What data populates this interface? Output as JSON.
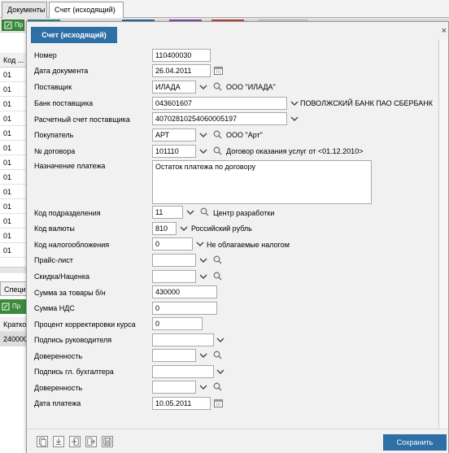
{
  "tabs": [
    {
      "label": "Документы"
    },
    {
      "label": "Счет (исходящий)",
      "close": "×"
    }
  ],
  "background": {
    "toolbar_label": "Пр",
    "column_header": "Код ...",
    "rows": [
      "01",
      "01",
      "01",
      "01",
      "01",
      "01",
      "01",
      "01",
      "01",
      "01",
      "01",
      "01",
      "01"
    ],
    "section_tab": "Специ",
    "section_toolbar_label": "Пр",
    "section_header": "Кратко",
    "section_row": "240000"
  },
  "dialog": {
    "title": "Счет (исходящий)",
    "close": "×",
    "fields": {
      "number": {
        "label": "Номер",
        "value": "110400030"
      },
      "doc_date": {
        "label": "Дата документа",
        "value": "26.04.2011"
      },
      "supplier": {
        "label": "Поставщик",
        "value": "ИЛАДА",
        "desc": "ООО \"ИЛАДА\""
      },
      "supplier_bank": {
        "label": "Банк поставщика",
        "value": "043601607",
        "desc": "ПОВОЛЖСКИЙ БАНК ПАО СБЕРБАНК"
      },
      "supplier_account": {
        "label": "Расчетный счет поставщика",
        "value": "40702810254060005197"
      },
      "buyer": {
        "label": "Покупатель",
        "value": "АРТ",
        "desc": "ООО \"Арт\""
      },
      "contract": {
        "label": "№ договора",
        "value": "101110",
        "desc": "Договор оказания услуг от <01.12.2010>"
      },
      "purpose": {
        "label": "Назначение платежа",
        "value": "Остаток платежа по договору"
      },
      "department": {
        "label": "Код подразделения",
        "value": "11",
        "desc": "Центр разработки"
      },
      "currency": {
        "label": "Код валюты",
        "value": "810",
        "desc": "Российский рубль"
      },
      "tax": {
        "label": "Код налогообложения",
        "value": "0",
        "desc": "Не облагаемые налогом"
      },
      "price_list": {
        "label": "Прайс-лист",
        "value": ""
      },
      "discount": {
        "label": "Скидка/Наценка",
        "value": ""
      },
      "goods_sum": {
        "label": "Сумма за товары б/н",
        "value": "430000"
      },
      "vat_sum": {
        "label": "Сумма НДС",
        "value": "0"
      },
      "rate_adjust": {
        "label": "Процент корректировки курса",
        "value": "0"
      },
      "head_sign": {
        "label": "Подпись руководителя",
        "value": ""
      },
      "proxy1": {
        "label": "Доверенность",
        "value": ""
      },
      "accountant_sign": {
        "label": "Подпись гл. бухгалтера",
        "value": ""
      },
      "proxy2": {
        "label": "Доверенность",
        "value": ""
      },
      "pay_date": {
        "label": "Дата платежа",
        "value": "10.05.2011"
      }
    },
    "save_label": "Сохранить"
  },
  "colors": {
    "accent": "#2e6fa6",
    "dialog_bg": "#f1f1f1"
  },
  "icons": {
    "dropdown": "chevron-down-icon",
    "search": "search-icon",
    "calendar": "calendar-icon"
  }
}
